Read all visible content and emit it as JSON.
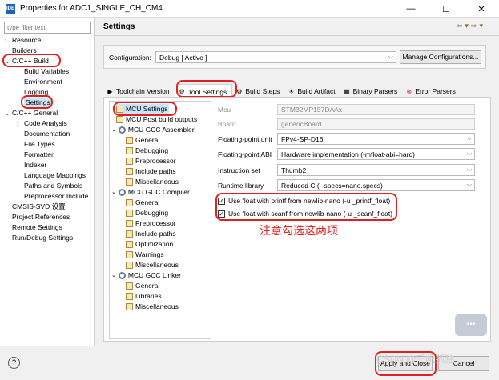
{
  "window": {
    "title": "Properties for ADC1_SINGLE_CH_CM4",
    "app_icon": "IDE",
    "min": "—",
    "max": "☐",
    "close": "✕"
  },
  "left": {
    "filter_placeholder": "type filter text",
    "items": [
      {
        "label": "Resource",
        "arrow": "›"
      },
      {
        "label": "Builders",
        "arrow": ""
      },
      {
        "label": "C/C++ Build",
        "arrow": "⌄"
      },
      {
        "label": "Build Variables",
        "arrow": ""
      },
      {
        "label": "Environment",
        "arrow": ""
      },
      {
        "label": "Logging",
        "arrow": ""
      },
      {
        "label": "Settings",
        "arrow": ""
      },
      {
        "label": "C/C++ General",
        "arrow": "⌄"
      },
      {
        "label": "Code Analysis",
        "arrow": "›"
      },
      {
        "label": "Documentation",
        "arrow": ""
      },
      {
        "label": "File Types",
        "arrow": ""
      },
      {
        "label": "Formatter",
        "arrow": ""
      },
      {
        "label": "Indexer",
        "arrow": ""
      },
      {
        "label": "Language Mappings",
        "arrow": ""
      },
      {
        "label": "Paths and Symbols",
        "arrow": ""
      },
      {
        "label": "Preprocessor Include",
        "arrow": ""
      },
      {
        "label": "CMSIS-SVD 设置",
        "arrow": ""
      },
      {
        "label": "Project References",
        "arrow": ""
      },
      {
        "label": "Remote Settings",
        "arrow": ""
      },
      {
        "label": "Run/Debug Settings",
        "arrow": ""
      }
    ]
  },
  "right": {
    "title": "Settings",
    "nav": {
      "back": "⇦",
      "back_menu": "▾",
      "forward": "⇨",
      "forward_menu": "▾",
      "menu": "⋮"
    },
    "configuration": {
      "label": "Configuration:",
      "value": "Debug  [ Active ]",
      "manage": "Manage Configurations..."
    },
    "tabs": [
      {
        "label": "Toolchain Version",
        "icon": "▶"
      },
      {
        "label": "Tool Settings",
        "icon": "⚙"
      },
      {
        "label": "Build Steps",
        "icon": "⚙"
      },
      {
        "label": "Build Artifact",
        "icon": "☀"
      },
      {
        "label": "Binary Parsers",
        "icon": "▦"
      },
      {
        "label": "Error Parsers",
        "icon": "⊗"
      }
    ],
    "tree": [
      "MCU Settings",
      "MCU Post build outputs",
      "MCU GCC Assembler",
      "General",
      "Debugging",
      "Preprocessor",
      "Include paths",
      "Miscellaneous",
      "MCU GCC Compiler",
      "General",
      "Debugging",
      "Preprocessor",
      "Include paths",
      "Optimization",
      "Warnings",
      "Miscellaneous",
      "MCU GCC Linker",
      "General",
      "Libraries",
      "Miscellaneous"
    ],
    "form": {
      "mcu_label": "Mcu",
      "mcu_value": "STM32MP157DAAx",
      "board_label": "Board",
      "board_value": "genericBoard",
      "fpu_label": "Floating-point unit",
      "fpu_value": "FPv4-SP-D16",
      "abi_label": "Floating-point ABI",
      "abi_value": "Hardware implementation (-mfloat-abi=hard)",
      "isa_label": "Instruction set",
      "isa_value": "Thumb2",
      "rt_label": "Runtime library",
      "rt_value": "Reduced C (--specs=nano.specs)",
      "printf_label": "Use float with printf from newlib-nano (-u _printf_float)",
      "scanf_label": "Use float with scanf from newlib-nano (-u _scanf_float)",
      "check": "✓"
    },
    "annotation": "注意勾选这两项"
  },
  "bottom": {
    "help": "?",
    "apply_close": "Apply and Close",
    "cancel": "Cancel",
    "watermark": "CSDN @千帆孤独"
  },
  "colors": {
    "annotation": "#e32020"
  }
}
